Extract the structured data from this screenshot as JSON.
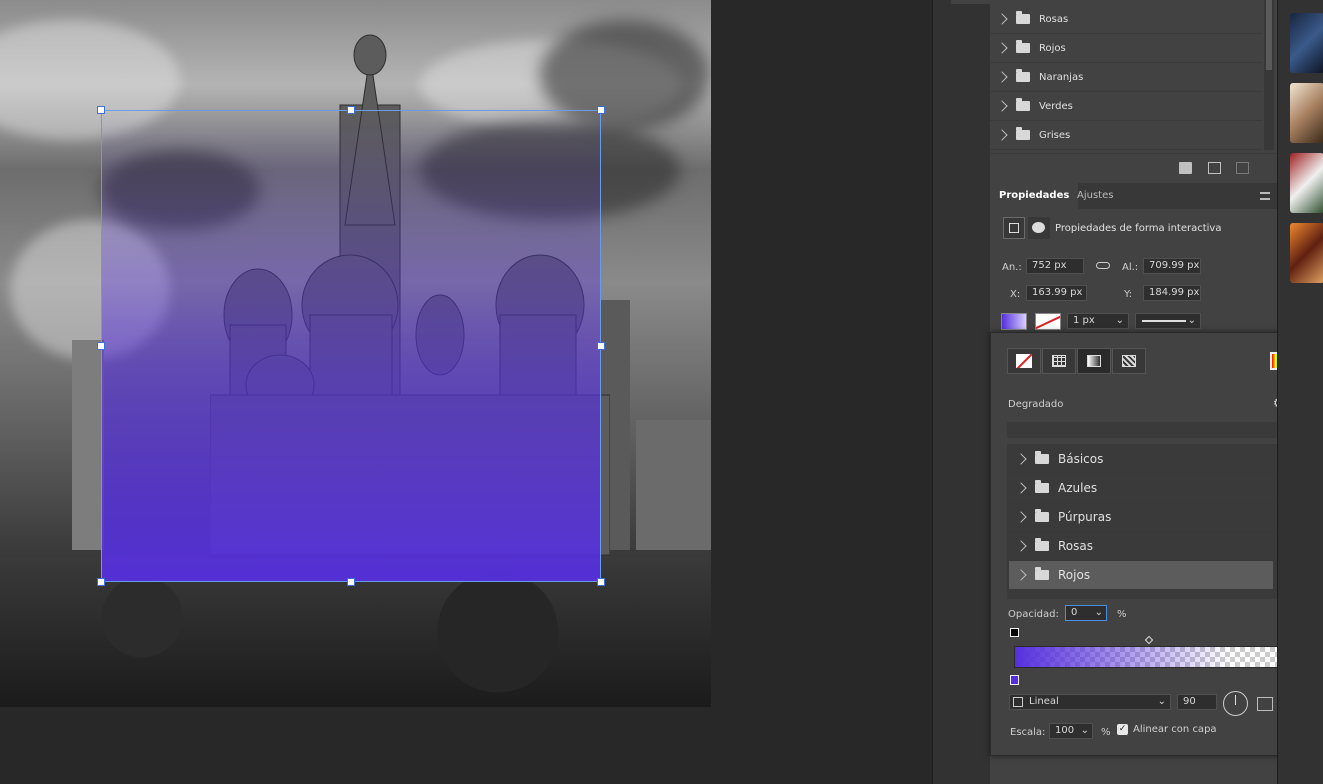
{
  "layers_folders": [
    "Rosas",
    "Rojos",
    "Naranjas",
    "Verdes",
    "Grises"
  ],
  "panel_tabs": {
    "properties": "Propiedades",
    "adjustments": "Ajustes"
  },
  "properties_title": "Propiedades de forma interactiva",
  "transform": {
    "width_label": "An.:",
    "width": "752 px",
    "height_label": "Al.:",
    "height": "709.99 px",
    "x_label": "X:",
    "x": "163.99 px",
    "y_label": "Y:",
    "y": "184.99 px"
  },
  "stroke_width": "1 px",
  "gradient_popup": {
    "title": "Degradado",
    "presets": [
      "Básicos",
      "Azules",
      "Púrpuras",
      "Rosas",
      "Rojos"
    ],
    "selected_preset": "Rojos",
    "opacity_label": "Opacidad:",
    "opacity_value": "0",
    "opacity_unit": "%",
    "gradient_type": "Lineal",
    "angle": "90",
    "scale_label": "Escala:",
    "scale_value": "100",
    "scale_unit": "%",
    "align_label": "Alinear con capa",
    "align_checked": true
  },
  "colors": {
    "gradient_start": "#5630de",
    "selection_border": "#6a9be8",
    "panel_bg": "#424242"
  }
}
